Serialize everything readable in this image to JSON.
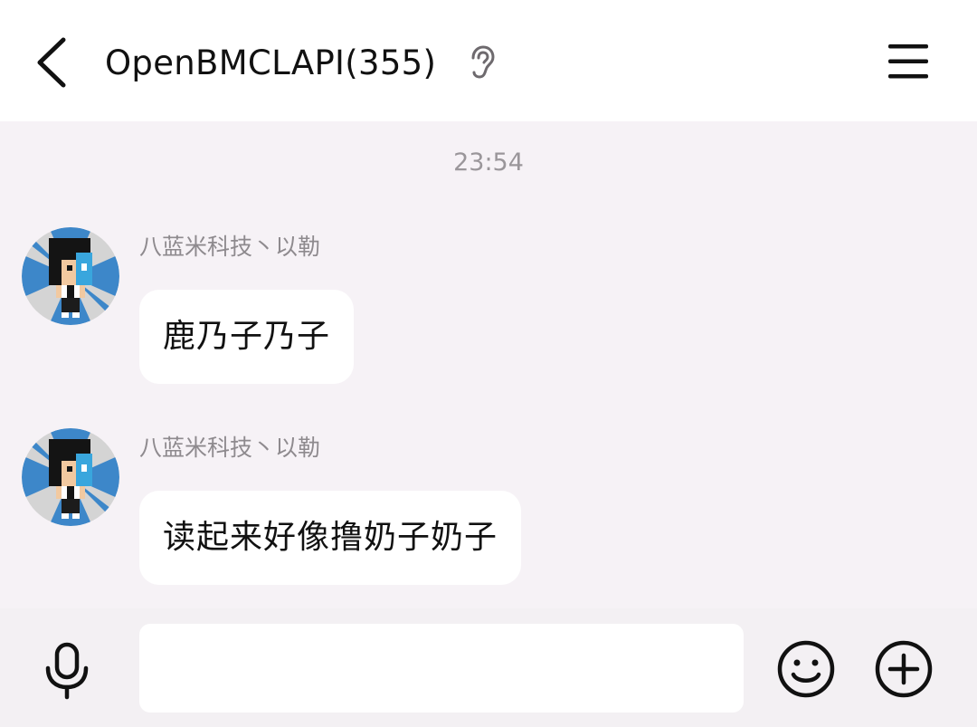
{
  "header": {
    "title": "OpenBMCLAPI(355)",
    "icons": {
      "back": "chevron-left-icon",
      "listen_mode": "ear-icon",
      "menu": "hamburger-menu-icon"
    }
  },
  "chat": {
    "timestamp": "23:54",
    "messages": [
      {
        "sender": "八蓝米科技丶以勒",
        "text": "鹿乃子乃子",
        "avatar": "pixel-character-avatar"
      },
      {
        "sender": "八蓝米科技丶以勒",
        "text": "读起来好像撸奶子奶子",
        "avatar": "pixel-character-avatar"
      }
    ]
  },
  "input_bar": {
    "value": "",
    "icons": {
      "voice": "microphone-icon",
      "emoji": "emoji-icon",
      "more": "plus-icon"
    }
  },
  "colors": {
    "header_bg": "#ffffff",
    "chat_bg": "#f6f2f6",
    "input_bar_bg": "#f3f0f3",
    "bubble_bg": "#ffffff",
    "text_primary": "#111111",
    "text_secondary": "#8e8a8e",
    "avatar_ring_blue": "#3d87c9"
  }
}
